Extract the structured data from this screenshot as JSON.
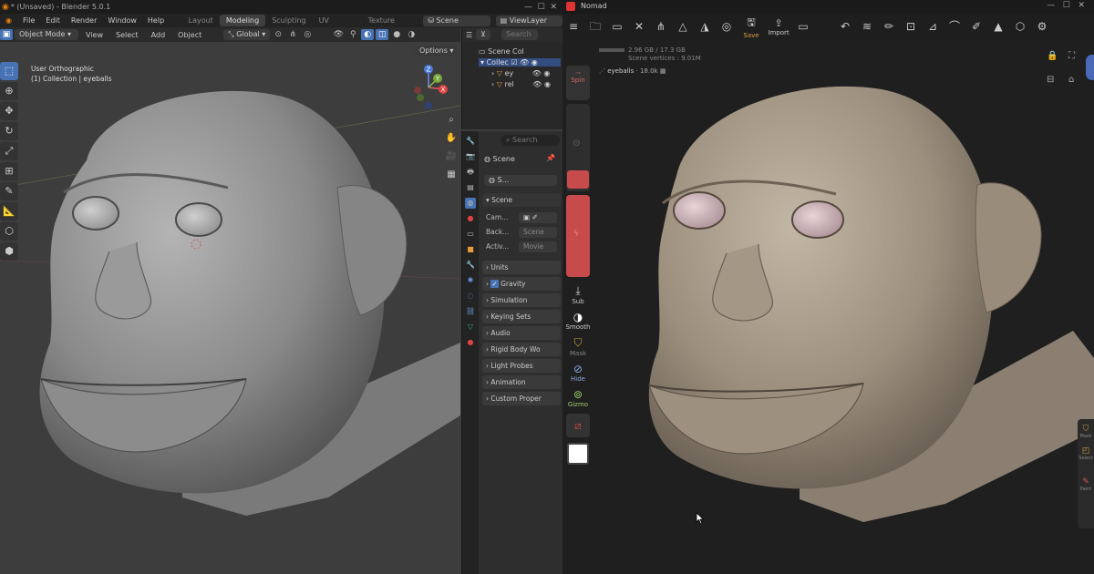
{
  "blender": {
    "title": "* (Unsaved) - Blender 5.0.1",
    "menus": [
      "File",
      "Edit",
      "Render",
      "Window",
      "Help"
    ],
    "workspaces": [
      "Layout",
      "Modeling",
      "Sculpting",
      "UV Editing",
      "Texture Paint"
    ],
    "active_workspace": "Modeling",
    "scene_name": "Scene",
    "view_layer": "ViewLayer",
    "mode": "Object Mode",
    "header_menus": [
      "View",
      "Select",
      "Add",
      "Object"
    ],
    "orientation": "Global",
    "options_label": "Options",
    "viewport_name": "User Orthographic",
    "viewport_collection": "(1) Collection | eyeballs",
    "gizmo_axes": {
      "x": "X",
      "y": "Y",
      "z": "Z"
    },
    "tool_icons": [
      "select-box-icon",
      "cursor-icon",
      "move-icon",
      "rotate-icon",
      "scale-icon",
      "transform-icon",
      "annotate-icon",
      "measure-icon",
      "add-cube-icon",
      "extrude-icon"
    ],
    "outliner": {
      "search_placeholder": "Search",
      "items": [
        {
          "label": "Scene Col"
        },
        {
          "label": "Collec"
        },
        {
          "label": "ey"
        },
        {
          "label": "rel"
        }
      ]
    },
    "properties": {
      "search_placeholder": "Search",
      "scene_label": "Scene",
      "scene_field": "S...",
      "scene_panel": "Scene",
      "scene_rows": [
        {
          "label": "Cam...",
          "value": ""
        },
        {
          "label": "Back...",
          "value": "Scene"
        },
        {
          "label": "Activ...",
          "value": "Movie"
        }
      ],
      "panels": [
        "Units",
        "Gravity",
        "Simulation",
        "Keying Sets",
        "Audio",
        "Rigid Body Wo",
        "Light Probes",
        "Animation",
        "Custom Proper"
      ],
      "gravity_checked": true
    }
  },
  "nomad": {
    "title": "Nomad",
    "toolbar_save": "Save",
    "toolbar_import": "Import",
    "memory": "2.96 GB / 17.3 GB",
    "scene_vertices": "Scene vertices : 9.01M",
    "selected_mesh": "eyeballs",
    "selected_count": "18.0k",
    "left_panel": {
      "top_label": "Spin",
      "sub": "Sub",
      "smooth": "Smooth",
      "mask": "Mask",
      "hide": "Hide",
      "gizmo": "Gizmo"
    },
    "slider_radius_color": "#c84b4b",
    "slider_intensity_color": "#c84b4b",
    "right_panel": [
      "Mask",
      "Select",
      "Paint"
    ]
  },
  "colors": {
    "blender_accent": "#4772b3",
    "nomad_red": "#c84b4b",
    "clay_gray": "#8f8f8f",
    "clay_beige": "#a89a88"
  }
}
